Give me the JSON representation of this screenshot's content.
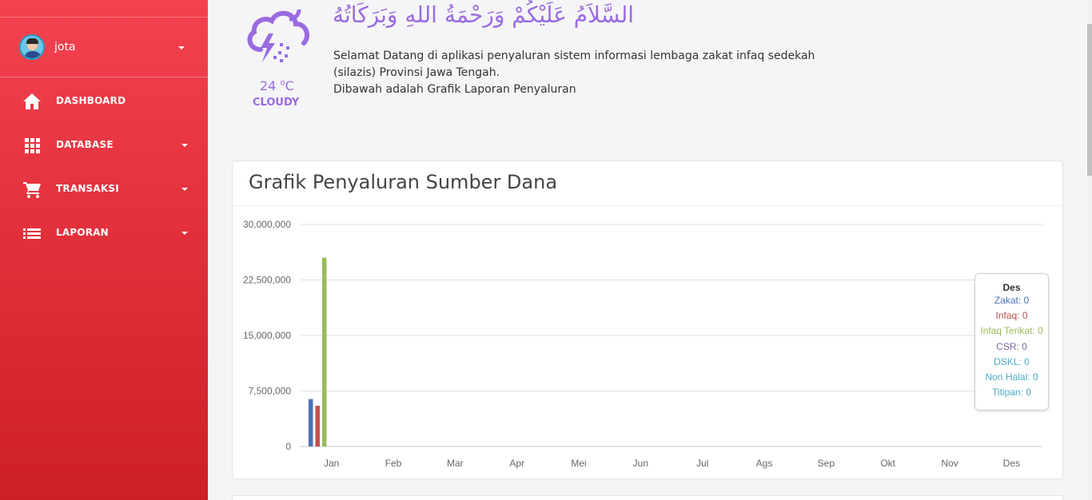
{
  "sidebar": {
    "user": {
      "name": "jota"
    },
    "menu": [
      {
        "label": "DASHBOARD",
        "icon": "home-icon",
        "has_submenu": false
      },
      {
        "label": "DATABASE",
        "icon": "grid-icon",
        "has_submenu": true
      },
      {
        "label": "TRANSAKSI",
        "icon": "cart-icon",
        "has_submenu": true
      },
      {
        "label": "LAPORAN",
        "icon": "list-icon",
        "has_submenu": true
      }
    ]
  },
  "weather": {
    "temp": "24",
    "unit": "C",
    "condition": "CLOUDY",
    "icon": "cloud-thunder-icon"
  },
  "greeting": {
    "arabic": "السَّلاَمُ عَلَيْكُمْ وَرَحْمَةُ اللهِ وَبَرَكَاتُهُ",
    "line1": "Selamat Datang di aplikasi penyaluran sistem informasi lembaga zakat infaq sedekah (silazis) Provinsi Jawa Tengah.",
    "line2": "Dibawah adalah Grafik Laporan Penyaluran"
  },
  "card": {
    "title": "Grafik Penyaluran Sumber Dana"
  },
  "colors": {
    "accent": "#9a6be0",
    "sidebar": "#e2313c"
  },
  "chart_data": {
    "type": "bar",
    "categories": [
      "Jan",
      "Feb",
      "Mar",
      "Apr",
      "Mei",
      "Jun",
      "Jul",
      "Ags",
      "Sep",
      "Okt",
      "Nov",
      "Des"
    ],
    "ylim": [
      0,
      30000000
    ],
    "yticks": [
      "0",
      "7,500,000",
      "15,000,000",
      "22,500,000",
      "30,000,000"
    ],
    "ytick_values": [
      0,
      7500000,
      15000000,
      22500000,
      30000000
    ],
    "series": [
      {
        "name": "Zakat",
        "color": "#4a72b8",
        "values": [
          6400000,
          0,
          0,
          0,
          0,
          0,
          0,
          0,
          0,
          0,
          0,
          0
        ]
      },
      {
        "name": "Infaq",
        "color": "#c0504d",
        "values": [
          5500000,
          0,
          0,
          0,
          0,
          0,
          0,
          0,
          0,
          0,
          0,
          0
        ]
      },
      {
        "name": "Infaq Terikat",
        "color": "#9bbb59",
        "values": [
          25500000,
          0,
          0,
          0,
          0,
          0,
          0,
          0,
          0,
          0,
          0,
          0
        ]
      },
      {
        "name": "CSR",
        "color": "#8064a2",
        "values": [
          0,
          0,
          0,
          0,
          0,
          0,
          0,
          0,
          0,
          0,
          0,
          0
        ]
      },
      {
        "name": "DSKL",
        "color": "#4bacc6",
        "values": [
          0,
          0,
          0,
          0,
          0,
          0,
          0,
          0,
          0,
          0,
          0,
          0
        ]
      },
      {
        "name": "Non Halal",
        "color": "#4bacc6",
        "values": [
          0,
          0,
          0,
          0,
          0,
          0,
          0,
          0,
          0,
          0,
          0,
          0
        ]
      },
      {
        "name": "Titipan",
        "color": "#4bacc6",
        "values": [
          0,
          0,
          0,
          0,
          0,
          0,
          0,
          0,
          0,
          0,
          0,
          0
        ]
      }
    ],
    "grid": true,
    "tooltip": {
      "title": "Des",
      "rows": [
        {
          "text": "Zakat: 0",
          "color": "#4a72b8"
        },
        {
          "text": "Infaq: 0",
          "color": "#c0504d"
        },
        {
          "text": "Infaq Terikat: 0",
          "color": "#9bbb59"
        },
        {
          "text": "CSR: 0",
          "color": "#8064a2"
        },
        {
          "text": "DSKL: 0",
          "color": "#4bacc6"
        },
        {
          "text": "Non Halal: 0",
          "color": "#4bacc6"
        },
        {
          "text": "Titipan: 0",
          "color": "#4bacc6"
        }
      ]
    }
  }
}
